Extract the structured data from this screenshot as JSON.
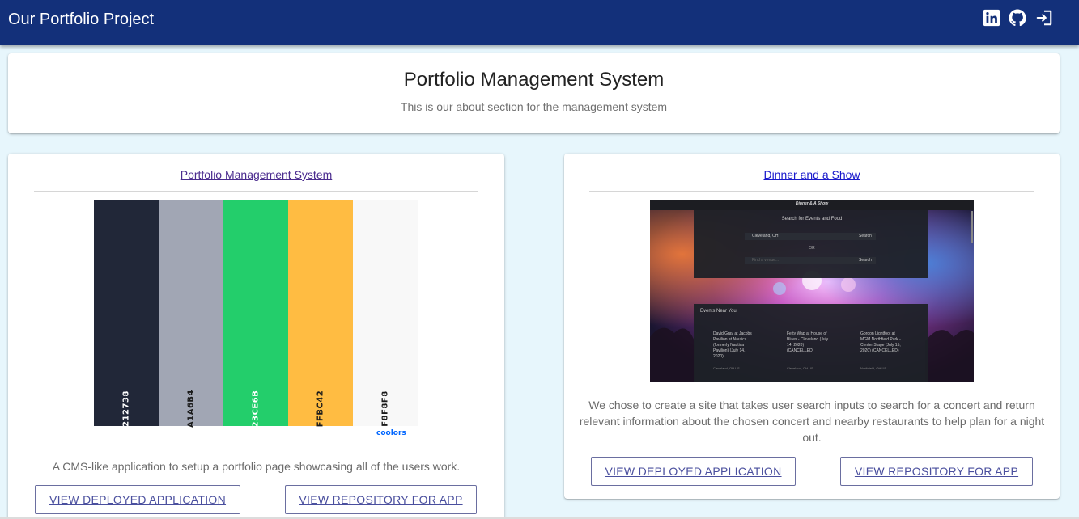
{
  "navbar": {
    "brand": "Our Portfolio Project",
    "icons": [
      "linkedin-icon",
      "github-icon",
      "sign-out-icon"
    ],
    "bg": "#13307a"
  },
  "about": {
    "title": "Portfolio Management System",
    "text": "This is our about section for the management system"
  },
  "projects": [
    {
      "title": "Portfolio Management System",
      "palette": [
        {
          "hex": "212738",
          "color": "#212738",
          "text_color": "#ffffff"
        },
        {
          "hex": "A1A6B4",
          "color": "#a1a6b4",
          "text_color": "#1a1a1a"
        },
        {
          "hex": "23CE6B",
          "color": "#23ce6b",
          "text_color": "#ffffff"
        },
        {
          "hex": "FFBC42",
          "color": "#ffbc42",
          "text_color": "#1a1a1a"
        },
        {
          "hex": "F8F8F8",
          "color": "#f8f8f8",
          "text_color": "#1a1a1a"
        }
      ],
      "palette_brand": "coolors",
      "description": "A CMS-like application to setup a portfolio page showcasing all of the users work.",
      "deployed_label": "VIEW DEPLOYED APPLICATION",
      "repo_label": "VIEW REPOSITORY FOR APP"
    },
    {
      "title": "Dinner and a Show",
      "screenshot": {
        "header": "Dinner & A Show",
        "search_heading": "Search for Events and Food",
        "city_value": "Cleveland, OH",
        "search_btn": "Search",
        "or": "OR",
        "food_placeholder": "Find a venue...",
        "search_btn2": "Search",
        "events_heading": "Events Near You",
        "events": [
          {
            "name": "David Gray at Jacobs Pavilion at Nautica (formerly Nautica Pavilion) (July 14, 2020)",
            "meta": "Cleveland, OH US"
          },
          {
            "name": "Fetty Wap at House of Blues - Cleveland (July 14, 2020) (CANCELLED)",
            "meta": "Cleveland, OH US"
          },
          {
            "name": "Gordon Lightfoot at MGM Northfield Park - Center Stage (July 15, 2020) (CANCELLED)",
            "meta": "Northfield, OH US"
          }
        ]
      },
      "description": "We chose to create a site that takes user search inputs to search for a concert and return relevant information about the chosen concert and nearby restaurants to help plan for a night out.",
      "deployed_label": "VIEW DEPLOYED APPLICATION",
      "repo_label": "VIEW REPOSITORY FOR APP"
    }
  ]
}
